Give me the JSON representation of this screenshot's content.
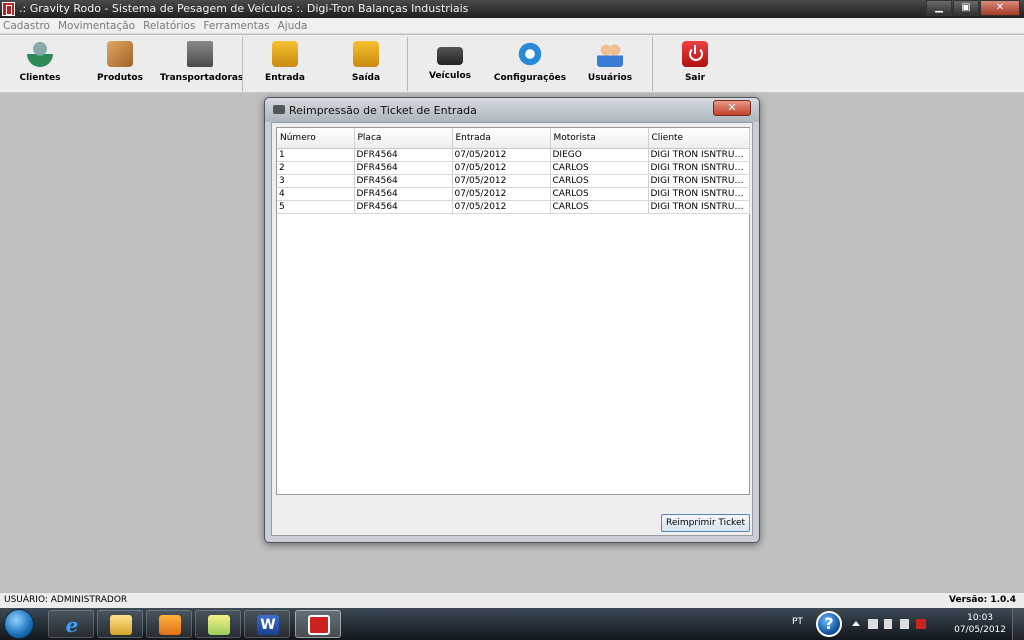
{
  "window": {
    "title": ".: Gravity Rodo - Sistema de Pesagem de Veículos :.  Digi-Tron Balanças Industriais",
    "minimize_glyph": "▁",
    "maximize_glyph": "▣",
    "close_glyph": "✕"
  },
  "menu": [
    "Cadastro",
    "Movimentação",
    "Relatórios",
    "Ferramentas",
    "Ajuda"
  ],
  "toolbar": {
    "clientes": "Clientes",
    "produtos": "Produtos",
    "transportadoras": "Transportadoras",
    "entrada": "Entrada",
    "saida": "Saída",
    "veiculos": "Veículos",
    "configuracoes": "Configurações",
    "usuarios": "Usuários",
    "sair": "Sair"
  },
  "dialog": {
    "title": "Reimpressão de Ticket de Entrada",
    "close_glyph": "✕",
    "columns": [
      "Número",
      "Placa",
      "Entrada",
      "Motorista",
      "Cliente"
    ],
    "rows": [
      {
        "numero": "1",
        "placa": "DFR4564",
        "entrada": "07/05/2012",
        "motorista": "DIEGO",
        "cliente": "DIGI TRON ISNTRUME..."
      },
      {
        "numero": "2",
        "placa": "DFR4564",
        "entrada": "07/05/2012",
        "motorista": "CARLOS",
        "cliente": "DIGI TRON ISNTRUME..."
      },
      {
        "numero": "3",
        "placa": "DFR4564",
        "entrada": "07/05/2012",
        "motorista": "CARLOS",
        "cliente": "DIGI TRON ISNTRUME..."
      },
      {
        "numero": "4",
        "placa": "DFR4564",
        "entrada": "07/05/2012",
        "motorista": "CARLOS",
        "cliente": "DIGI TRON ISNTRUME..."
      },
      {
        "numero": "5",
        "placa": "DFR4564",
        "entrada": "07/05/2012",
        "motorista": "CARLOS",
        "cliente": "DIGI TRON ISNTRUME..."
      }
    ],
    "reprint_button": "Reimprimir Ticket"
  },
  "status": {
    "user": "USUÁRIO: ADMINISTRADOR",
    "version": "Versão: 1.0.4"
  },
  "taskbar": {
    "language": "PT",
    "help_glyph": "?",
    "ie_glyph": "e",
    "word_glyph": "W",
    "time": "10:03",
    "date": "07/05/2012"
  },
  "icons": [
    "clientes-icon",
    "produtos-icon",
    "transportadoras-icon",
    "entrada-icon",
    "saida-icon",
    "veiculos-icon",
    "configuracoes-icon",
    "usuarios-icon",
    "sair-icon"
  ]
}
